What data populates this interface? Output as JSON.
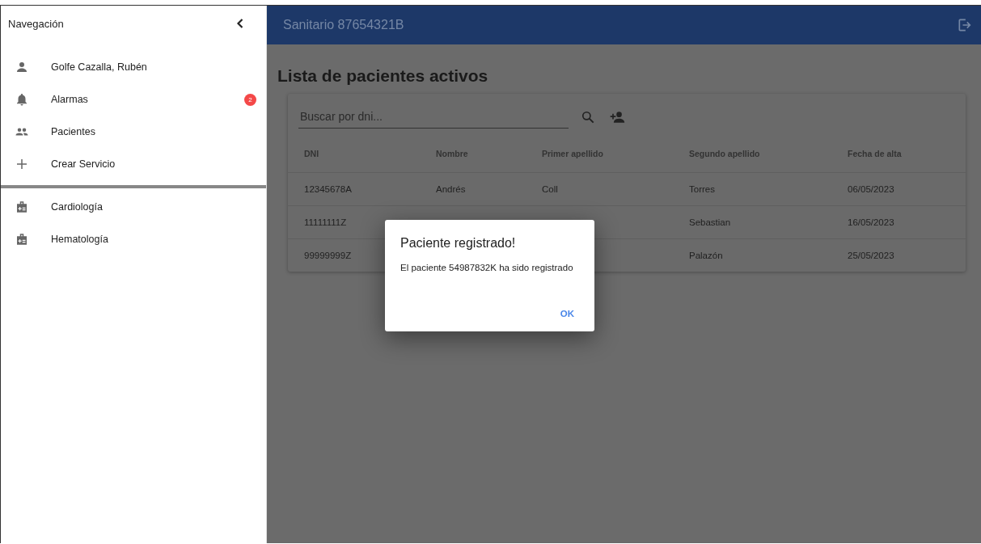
{
  "sidebar": {
    "title": "Navegación",
    "items": [
      {
        "label": "Golfe Cazalla, Rubén",
        "kind": "person"
      },
      {
        "label": "Alarmas",
        "kind": "bell",
        "badge": "2"
      },
      {
        "label": "Pacientes",
        "kind": "people"
      },
      {
        "label": "Crear Servicio",
        "kind": "plus"
      }
    ],
    "services": [
      {
        "label": "Cardiología"
      },
      {
        "label": "Hematología"
      }
    ]
  },
  "header": {
    "title": "Sanitario 87654321B"
  },
  "page_title": "Lista de pacientes activos",
  "search": {
    "placeholder": "Buscar por dni..."
  },
  "table": {
    "columns": [
      "DNI",
      "Nombre",
      "Primer apellido",
      "Segundo apellido",
      "Fecha de alta"
    ],
    "rows": [
      [
        "12345678A",
        "Andrés",
        "Coll",
        "Torres",
        "06/05/2023"
      ],
      [
        "11111111Z",
        null,
        null,
        "Sebastian",
        "16/05/2023"
      ],
      [
        "99999999Z",
        null,
        null,
        "Palazón",
        "25/05/2023"
      ]
    ]
  },
  "dialog": {
    "title": "Paciente registrado!",
    "message": "El paciente 54987832K ha sido registrado",
    "button": "OK"
  }
}
